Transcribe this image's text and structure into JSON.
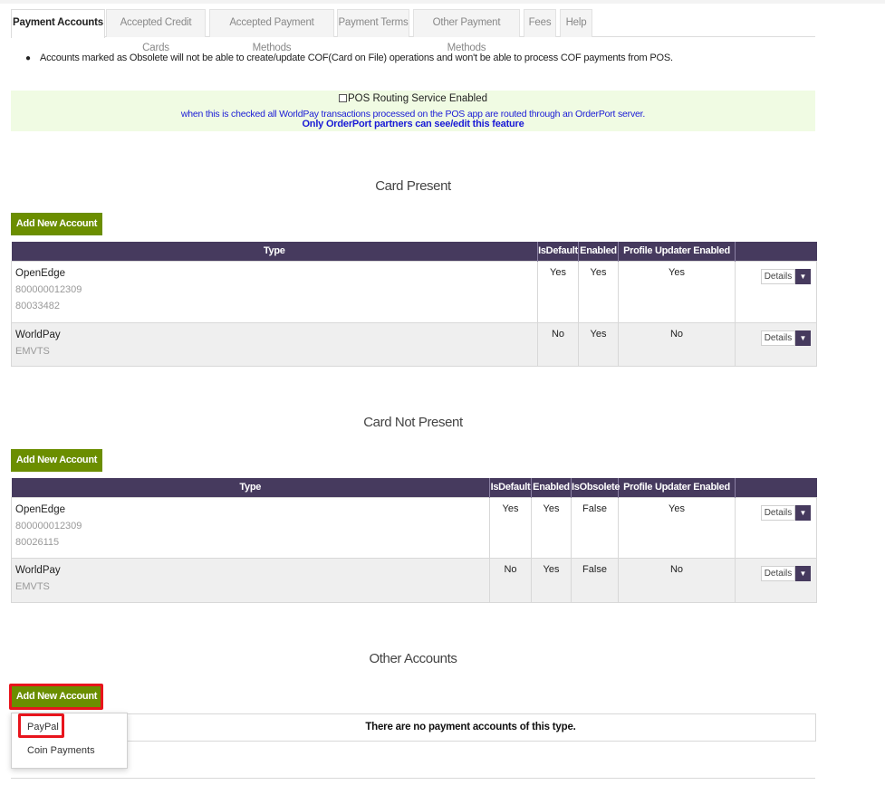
{
  "tabs": [
    {
      "label": "Payment Accounts",
      "active": true
    },
    {
      "label": "Accepted Credit Cards",
      "active": false
    },
    {
      "label": "Accepted Payment Methods",
      "active": false
    },
    {
      "label": "Payment Terms",
      "active": false
    },
    {
      "label": "Other Payment Methods",
      "active": false
    },
    {
      "label": "Fees",
      "active": false
    },
    {
      "label": "Help",
      "active": false
    }
  ],
  "notice": "Accounts marked as Obsolete will not be able to create/update COF(Card on File) operations and won't be able to process COF payments from POS.",
  "pos_routing": {
    "checkbox_label": "POS Routing Service Enabled",
    "checked": false,
    "description": "when this is checked all WorldPay transactions processed on the POS app are routed through an OrderPort server.",
    "partner_note": "Only OrderPort partners can see/edit this feature"
  },
  "card_present": {
    "title": "Card Present",
    "add_button": "Add New Account",
    "headers": [
      "Type",
      "IsDefault",
      "Enabled",
      "Profile Updater Enabled",
      ""
    ],
    "rows": [
      {
        "name": "OpenEdge",
        "sub1": "800000012309",
        "sub2": "80033482",
        "is_default": "Yes",
        "enabled": "Yes",
        "profile_updater": "Yes",
        "details": "Details"
      },
      {
        "name": "WorldPay",
        "sub1": "EMVTS",
        "sub2": "",
        "is_default": "No",
        "enabled": "Yes",
        "profile_updater": "No",
        "details": "Details"
      }
    ]
  },
  "card_not_present": {
    "title": "Card Not Present",
    "add_button": "Add New Account",
    "headers": [
      "Type",
      "IsDefault",
      "Enabled",
      "IsObsolete",
      "Profile Updater Enabled",
      ""
    ],
    "rows": [
      {
        "name": "OpenEdge",
        "sub1": "800000012309",
        "sub2": "80026115",
        "is_default": "Yes",
        "enabled": "Yes",
        "is_obsolete": "False",
        "profile_updater": "Yes",
        "details": "Details"
      },
      {
        "name": "WorldPay",
        "sub1": "EMVTS",
        "sub2": "",
        "is_default": "No",
        "enabled": "Yes",
        "is_obsolete": "False",
        "profile_updater": "No",
        "details": "Details"
      }
    ]
  },
  "other_accounts": {
    "title": "Other Accounts",
    "add_button": "Add New Account",
    "empty_message": "There are no payment accounts of this type.",
    "dropdown_items": [
      "PayPal",
      "Coin Payments"
    ]
  },
  "colors": {
    "header_purple": "#463a5e",
    "button_green": "#6b8e00",
    "highlight_red": "#e8141c",
    "notice_bg": "#f0fbe3",
    "notice_link": "#1a1ad6"
  },
  "icons": {
    "caret": "caret-down-icon",
    "checkbox": "checkbox-icon"
  }
}
